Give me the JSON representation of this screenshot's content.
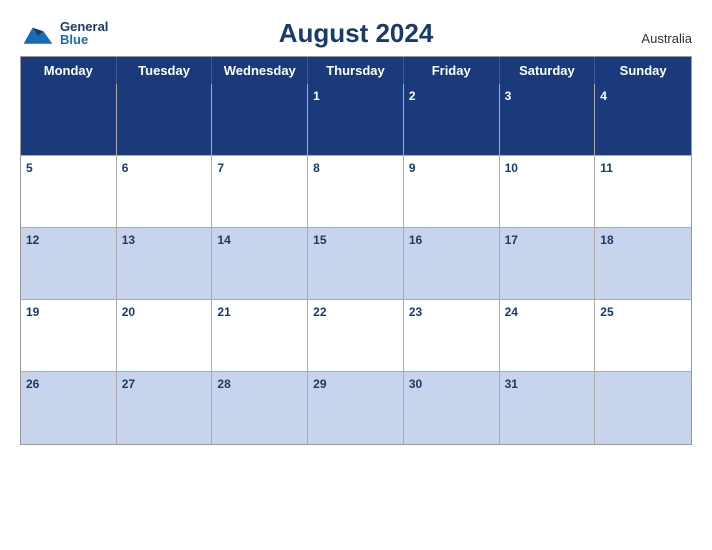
{
  "header": {
    "logo_general": "General",
    "logo_blue": "Blue",
    "title": "August 2024",
    "country": "Australia"
  },
  "dayHeaders": [
    "Monday",
    "Tuesday",
    "Wednesday",
    "Thursday",
    "Friday",
    "Saturday",
    "Sunday"
  ],
  "weeks": [
    [
      {
        "num": "",
        "rowStyle": "header"
      },
      {
        "num": "",
        "rowStyle": "header"
      },
      {
        "num": "",
        "rowStyle": "header"
      },
      {
        "num": "1",
        "rowStyle": "header"
      },
      {
        "num": "2",
        "rowStyle": "header"
      },
      {
        "num": "3",
        "rowStyle": "header"
      },
      {
        "num": "4",
        "rowStyle": "header"
      }
    ],
    [
      {
        "num": "5"
      },
      {
        "num": "6"
      },
      {
        "num": "7"
      },
      {
        "num": "8"
      },
      {
        "num": "9"
      },
      {
        "num": "10"
      },
      {
        "num": "11"
      }
    ],
    [
      {
        "num": "12"
      },
      {
        "num": "13"
      },
      {
        "num": "14"
      },
      {
        "num": "15"
      },
      {
        "num": "16"
      },
      {
        "num": "17"
      },
      {
        "num": "18"
      }
    ],
    [
      {
        "num": "19"
      },
      {
        "num": "20"
      },
      {
        "num": "21"
      },
      {
        "num": "22"
      },
      {
        "num": "23"
      },
      {
        "num": "24"
      },
      {
        "num": "25"
      }
    ],
    [
      {
        "num": "26"
      },
      {
        "num": "27"
      },
      {
        "num": "28"
      },
      {
        "num": "29"
      },
      {
        "num": "30"
      },
      {
        "num": "31"
      },
      {
        "num": ""
      }
    ]
  ],
  "colors": {
    "headerBg": "#1a3a7c",
    "rowBlueBg": "#c8d3ec",
    "rowWhiteBg": "#ffffff",
    "headerTextColor": "#ffffff",
    "dateNumBlue": "#1a3a6b"
  }
}
